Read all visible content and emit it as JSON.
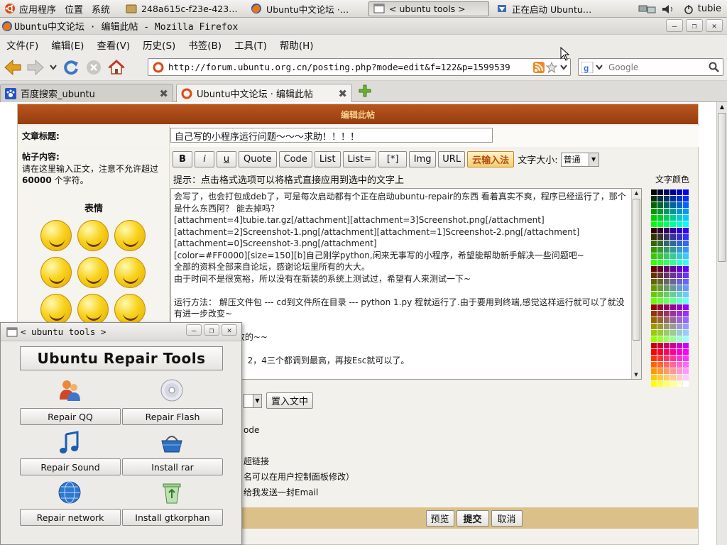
{
  "panel": {
    "menus": [
      "应用程序",
      "位置",
      "系统"
    ],
    "tasks": [
      {
        "label": "248a615c-f23e-423…"
      },
      {
        "label": "Ubuntu中文论坛 ·…"
      },
      {
        "label": "< ubuntu tools >"
      },
      {
        "label": "正在启动 Ubuntu…"
      }
    ],
    "user": "tubie"
  },
  "firefox": {
    "window_title": "Ubuntu中文论坛 · 编辑此帖 - Mozilla Firefox",
    "menu": [
      "文件(F)",
      "编辑(E)",
      "查看(V)",
      "历史(S)",
      "书签(B)",
      "工具(T)",
      "帮助(H)"
    ],
    "url": "http://forum.ubuntu.org.cn/posting.php?mode=edit&f=122&p=1599539",
    "search_placeholder": "Google",
    "tabs": [
      {
        "label": "百度搜索_ubuntu"
      },
      {
        "label": "Ubuntu中文论坛 · 编辑此帖"
      }
    ]
  },
  "form": {
    "header": "编辑此帖",
    "subject_label": "文章标题:",
    "subject_value": "自己写的小程序运行问题～～～求助！！！！",
    "content_label": "帖子内容:",
    "content_hint_1": "请在这里输入正文，注意不允许超过",
    "content_hint_num": "60000",
    "content_hint_2": " 个字符。",
    "emoticons_label": "表情",
    "format_buttons": [
      "B",
      "i",
      "u",
      "Quote",
      "Code",
      "List",
      "List=",
      "[*]",
      "Img",
      "URL"
    ],
    "ime_button": "云输入法",
    "font_size_label": "文字大小:",
    "font_size_value": "普通",
    "tip": "提示：点击格式选项可以将格式直接应用到选中的文字上",
    "color_label": "文字颜色",
    "body_lines": [
      "会写了，也会打包成deb了，可是每次启动都有个正在启动ubuntu-repair的东西 看着真实不爽，程序已经运行了，那个是什么东西阿？ 能去掉吗？",
      "[attachment=4]tubie.tar.gz[/attachment][attachment=3]Screenshot.png[/attachment][attachment=2]Screenshot-1.png[/attachment][attachment=1]Screenshot-2.png[/attachment][attachment=0]Screenshot-3.png[/attachment]",
      "[color=#FF0000][size=150][b]自己刚学python,闲来无事写的小程序，希望能帮助新手解决一些问题吧~",
      "全部的资料全部来自论坛，感谢论坛里所有的大大。",
      "由于时间不是很宽裕，所以没有在新装的系统上测试过，希望有人来测试一下~",
      "",
      "运行方法：  解压文件包 --- cd到文件所在目录 --- python 1.py 程就运行了.由于要用到终端,感觉这样运行就可以了就没有进一步改变~",
      "",
      "给我 我会努力修改的~~",
      "",
      "音的修改只要把1，2，4三个都调到最高，再按Esc就可以了。"
    ],
    "attach_button": "置入文中",
    "options": [
      "ode",
      "超链接",
      "名可以在用户控制面板修改）",
      "给我发送一封Email"
    ],
    "preview_button": "预览",
    "submit_button": "提交",
    "cancel_button": "取消"
  },
  "tools": {
    "window_title": "< ubuntu tools >",
    "heading": "Ubuntu Repair Tools",
    "buttons": [
      "Repair QQ",
      "Repair Flash",
      "Repair Sound",
      "Install rar",
      "Repair network",
      "Install gtkorphan"
    ]
  }
}
